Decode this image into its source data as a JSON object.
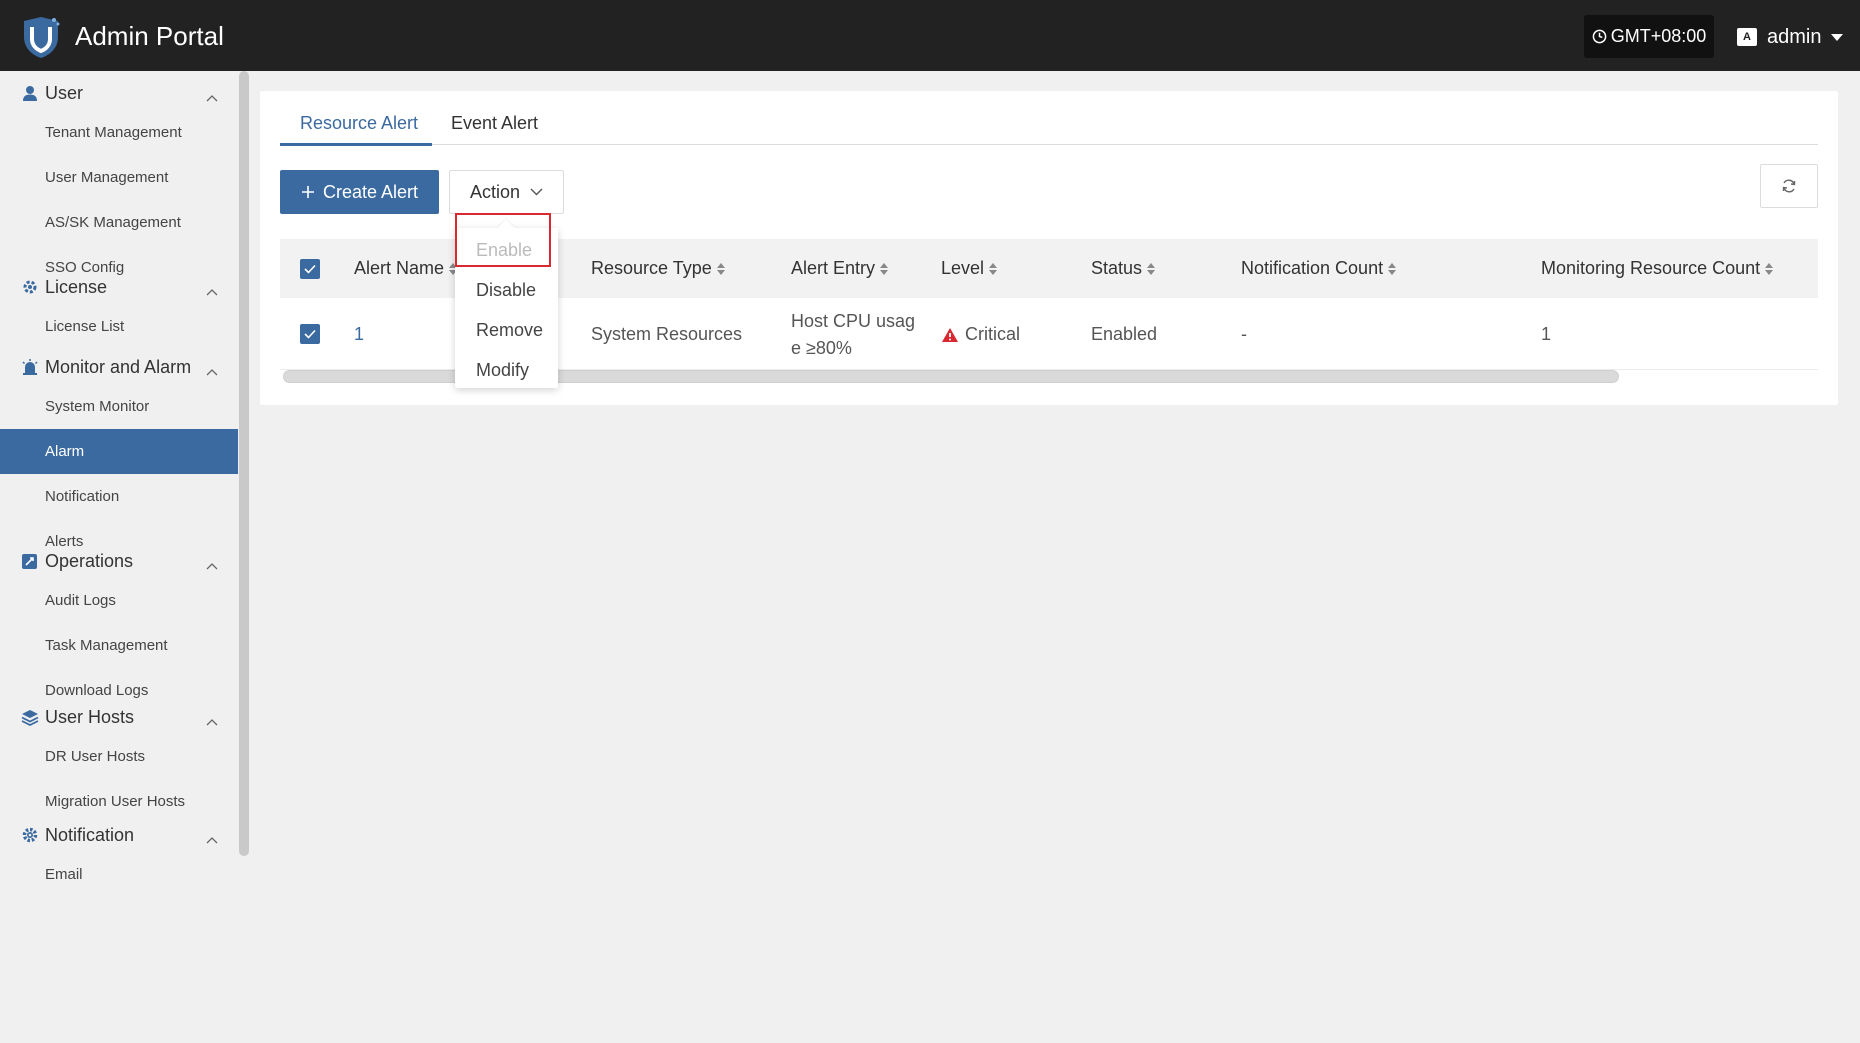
{
  "header": {
    "title": "Admin Portal",
    "timezone": "GMT+08:00",
    "user": "admin",
    "lang_icon_text": "A",
    "logo_icon": "shield-logo-icon"
  },
  "sidebar": {
    "groups": [
      {
        "label": "User",
        "icon": "user-icon",
        "items": [
          "Tenant Management",
          "User Management",
          "AS/SK Management",
          "SSO Config"
        ]
      },
      {
        "label": "License",
        "icon": "license-gear-icon",
        "items": [
          "License List"
        ]
      },
      {
        "label": "Monitor and Alarm",
        "icon": "alarm-icon",
        "items": [
          "System Monitor",
          "Alarm",
          "Notification",
          "Alerts"
        ]
      },
      {
        "label": "Operations",
        "icon": "operations-icon",
        "items": [
          "Audit Logs",
          "Task Management",
          "Download Logs"
        ]
      },
      {
        "label": "User Hosts",
        "icon": "layers-icon",
        "items": [
          "DR User Hosts",
          "Migration User Hosts"
        ]
      },
      {
        "label": "Notification",
        "icon": "gear-icon",
        "items": [
          "Email"
        ]
      }
    ],
    "active_item": "Alarm"
  },
  "tabs": [
    "Resource Alert",
    "Event Alert"
  ],
  "toolbar": {
    "create_label": "Create Alert",
    "action_label": "Action"
  },
  "action_menu": {
    "items": [
      "Enable",
      "Disable",
      "Remove",
      "Modify"
    ],
    "disabled": [
      "Enable"
    ]
  },
  "table": {
    "columns": [
      "Alert Name",
      "Resource Type",
      "Alert Entry",
      "Level",
      "Status",
      "Notification Count",
      "Monitoring Resource Count"
    ],
    "rows": [
      {
        "alert_name": "1",
        "resource_type": "System Resources",
        "alert_entry_line1": "Host CPU usag",
        "alert_entry_line2": "e ≥80%",
        "level": "Critical",
        "status": "Enabled",
        "notification_count": "-",
        "monitoring_resource_count": "1"
      }
    ]
  },
  "colors": {
    "accent": "#3b6aa0",
    "header_bg": "#222222",
    "critical": "#d9282f",
    "highlight": "#d9282f"
  }
}
